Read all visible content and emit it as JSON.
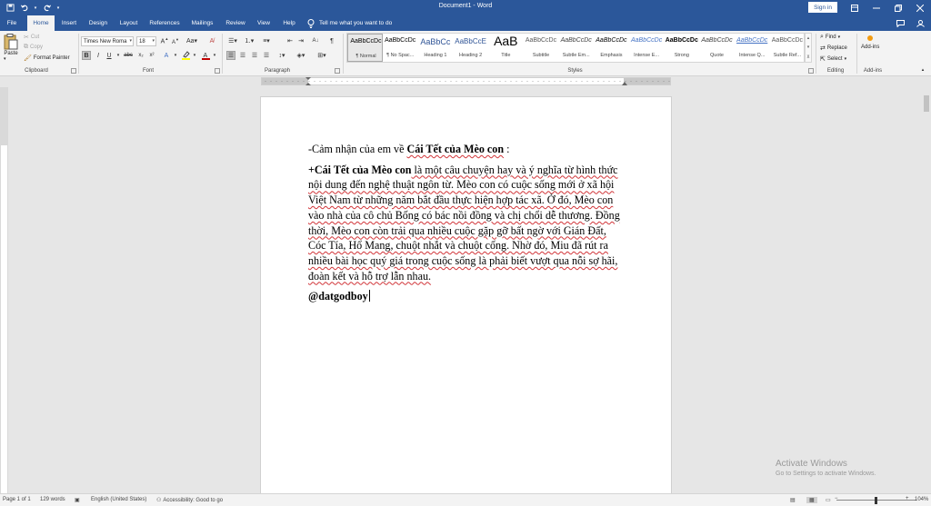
{
  "window": {
    "title": "Document1 - Word",
    "sign_in": "Sign in"
  },
  "tabs": [
    "File",
    "Home",
    "Insert",
    "Design",
    "Layout",
    "References",
    "Mailings",
    "Review",
    "View",
    "Help"
  ],
  "tell_me": "Tell me what you want to do",
  "clipboard": {
    "paste": "Paste",
    "cut": "Cut",
    "copy": "Copy",
    "format_painter": "Format Painter",
    "label": "Clipboard"
  },
  "font": {
    "family": "Times New Roma",
    "size": "18",
    "label": "Font"
  },
  "paragraph": {
    "label": "Paragraph"
  },
  "styles": {
    "label": "Styles",
    "items": [
      {
        "preview": "AaBbCcDc",
        "name": "¶ Normal"
      },
      {
        "preview": "AaBbCcDc",
        "name": "¶ No Spac..."
      },
      {
        "preview": "AaBbCc",
        "name": "Heading 1"
      },
      {
        "preview": "AaBbCcE",
        "name": "Heading 2"
      },
      {
        "preview": "AaB",
        "name": "Title"
      },
      {
        "preview": "AaBbCcDc",
        "name": "Subtitle"
      },
      {
        "preview": "AaBbCcDc",
        "name": "Subtle Em..."
      },
      {
        "preview": "AaBbCcDc",
        "name": "Emphasis"
      },
      {
        "preview": "AaBbCcDc",
        "name": "Intense E..."
      },
      {
        "preview": "AaBbCcDc",
        "name": "Strong"
      },
      {
        "preview": "AaBbCcDc",
        "name": "Quote"
      },
      {
        "preview": "AaBbCcDc",
        "name": "Intense Q..."
      },
      {
        "preview": "AaBbCcDc",
        "name": "Subtle Ref..."
      }
    ]
  },
  "editing": {
    "find": "Find",
    "replace": "Replace",
    "select": "Select",
    "label": "Editing"
  },
  "addins": {
    "button": "Add-ins",
    "label": "Add-ins"
  },
  "document": {
    "line1_prefix": "-Cảm nhận của em về ",
    "line1_bold": "Cái Tết của Mèo con",
    "line1_suffix": " :",
    "para_bold": "+Cái Tết của Mèo con",
    "para_text": " là một câu chuyện hay và ý nghĩa từ hình thức nội dung đến nghệ thuật ngôn từ. Mèo con có cuộc sống mới ở xã hội Việt Nam từ những năm bắt đầu thực hiện hợp tác xã. Ở đó, Mèo con vào nhà của cô chủ Bống có bác nồi đồng và chị chổi dễ thương. Đồng thời, Mèo con còn trải qua nhiều cuộc gặp gỡ bất ngờ với  Gián Đất, Cóc Tía, Hổ Mang, chuột nhắt và chuột cống. Nhờ đó, Miu đã rút ra nhiều bài học quý giá trong cuộc sống là phải biết vượt qua nỗi sợ hãi, đoàn kết và hỗ trợ lẫn nhau.",
    "signature": "@datgodboy"
  },
  "watermark": {
    "line1": "Activate Windows",
    "line2": "Go to Settings to activate Windows."
  },
  "status": {
    "page": "Page 1 of 1",
    "words": "129 words",
    "language": "English (United States)",
    "accessibility": "Accessibility: Good to go",
    "zoom": "104%"
  },
  "colors": {
    "accent": "#2b579a",
    "ribbon": "#f3f3f3",
    "workspace": "#e6e6e6",
    "spelling": "#d13438"
  }
}
